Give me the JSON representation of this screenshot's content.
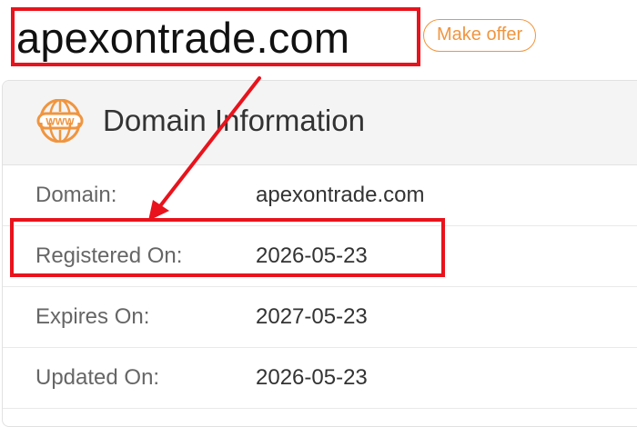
{
  "header": {
    "domain_name": "apexontrade.com",
    "make_offer_label": "Make offer"
  },
  "card": {
    "title": "Domain Information",
    "icon": "www-icon",
    "rows": [
      {
        "label": "Domain:",
        "value": "apexontrade.com"
      },
      {
        "label": "Registered On:",
        "value": "2026-05-23"
      },
      {
        "label": "Expires On:",
        "value": "2027-05-23"
      },
      {
        "label": "Updated On:",
        "value": "2026-05-23"
      }
    ]
  },
  "colors": {
    "accent": "#f0953f",
    "annotation": "#e8131c",
    "header_bg": "#f4f4f4"
  }
}
